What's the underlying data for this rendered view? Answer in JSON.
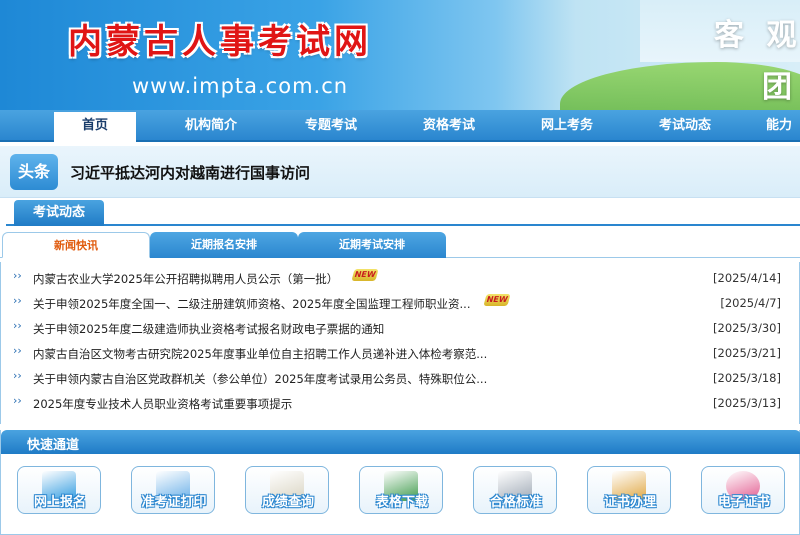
{
  "banner": {
    "site_title": "内蒙古人事考试网",
    "site_url": "www.impta.com.cn",
    "slogan_line1": "客 观",
    "slogan_line2": "团"
  },
  "nav": {
    "items": [
      {
        "label": "首页",
        "active": true
      },
      {
        "label": "机构简介"
      },
      {
        "label": "专题考试"
      },
      {
        "label": "资格考试"
      },
      {
        "label": "网上考务"
      },
      {
        "label": "考试动态"
      },
      {
        "label": "能力"
      }
    ]
  },
  "headline": {
    "badge": "头条",
    "text": "习近平抵达河内对越南进行国事访问"
  },
  "section": {
    "title": "考试动态"
  },
  "tabs": [
    {
      "label": "新闻快讯",
      "active": true
    },
    {
      "label": "近期报名安排"
    },
    {
      "label": "近期考试安排"
    }
  ],
  "news": [
    {
      "title": "内蒙古农业大学2025年公开招聘拟聘用人员公示（第一批）",
      "date": "[2025/4/14]",
      "new": true,
      "new_label": "NEW"
    },
    {
      "title": "关于申领2025年度全国一、二级注册建筑师资格、2025年度全国监理工程师职业资...",
      "date": "[2025/4/7]",
      "new": true,
      "new_label": "NEW"
    },
    {
      "title": "关于申领2025年度二级建造师执业资格考试报名财政电子票据的通知",
      "date": "[2025/3/30]",
      "new": false
    },
    {
      "title": "内蒙古自治区文物考古研究院2025年度事业单位自主招聘工作人员递补进入体检考察范...",
      "date": "[2025/3/21]",
      "new": false
    },
    {
      "title": "关于申领内蒙古自治区党政群机关（参公单位）2025年度考试录用公务员、特殊职位公...",
      "date": "[2025/3/18]",
      "new": false
    },
    {
      "title": "2025年度专业技术人员职业资格考试重要事项提示",
      "date": "[2025/3/13]",
      "new": false
    }
  ],
  "quick": {
    "title": "快速通道",
    "buttons": [
      {
        "label": "网上报名",
        "color": "#2f9be0"
      },
      {
        "label": "准考证打印",
        "color": "#6bb0e8"
      },
      {
        "label": "成绩查询",
        "color": "#d9d4c2"
      },
      {
        "label": "表格下载",
        "color": "#3d9a4a"
      },
      {
        "label": "合格标准",
        "color": "#9fa9b5"
      },
      {
        "label": "证书办理",
        "color": "#e0a640"
      },
      {
        "label": "电子证书",
        "color": "#e25b8f"
      }
    ]
  }
}
